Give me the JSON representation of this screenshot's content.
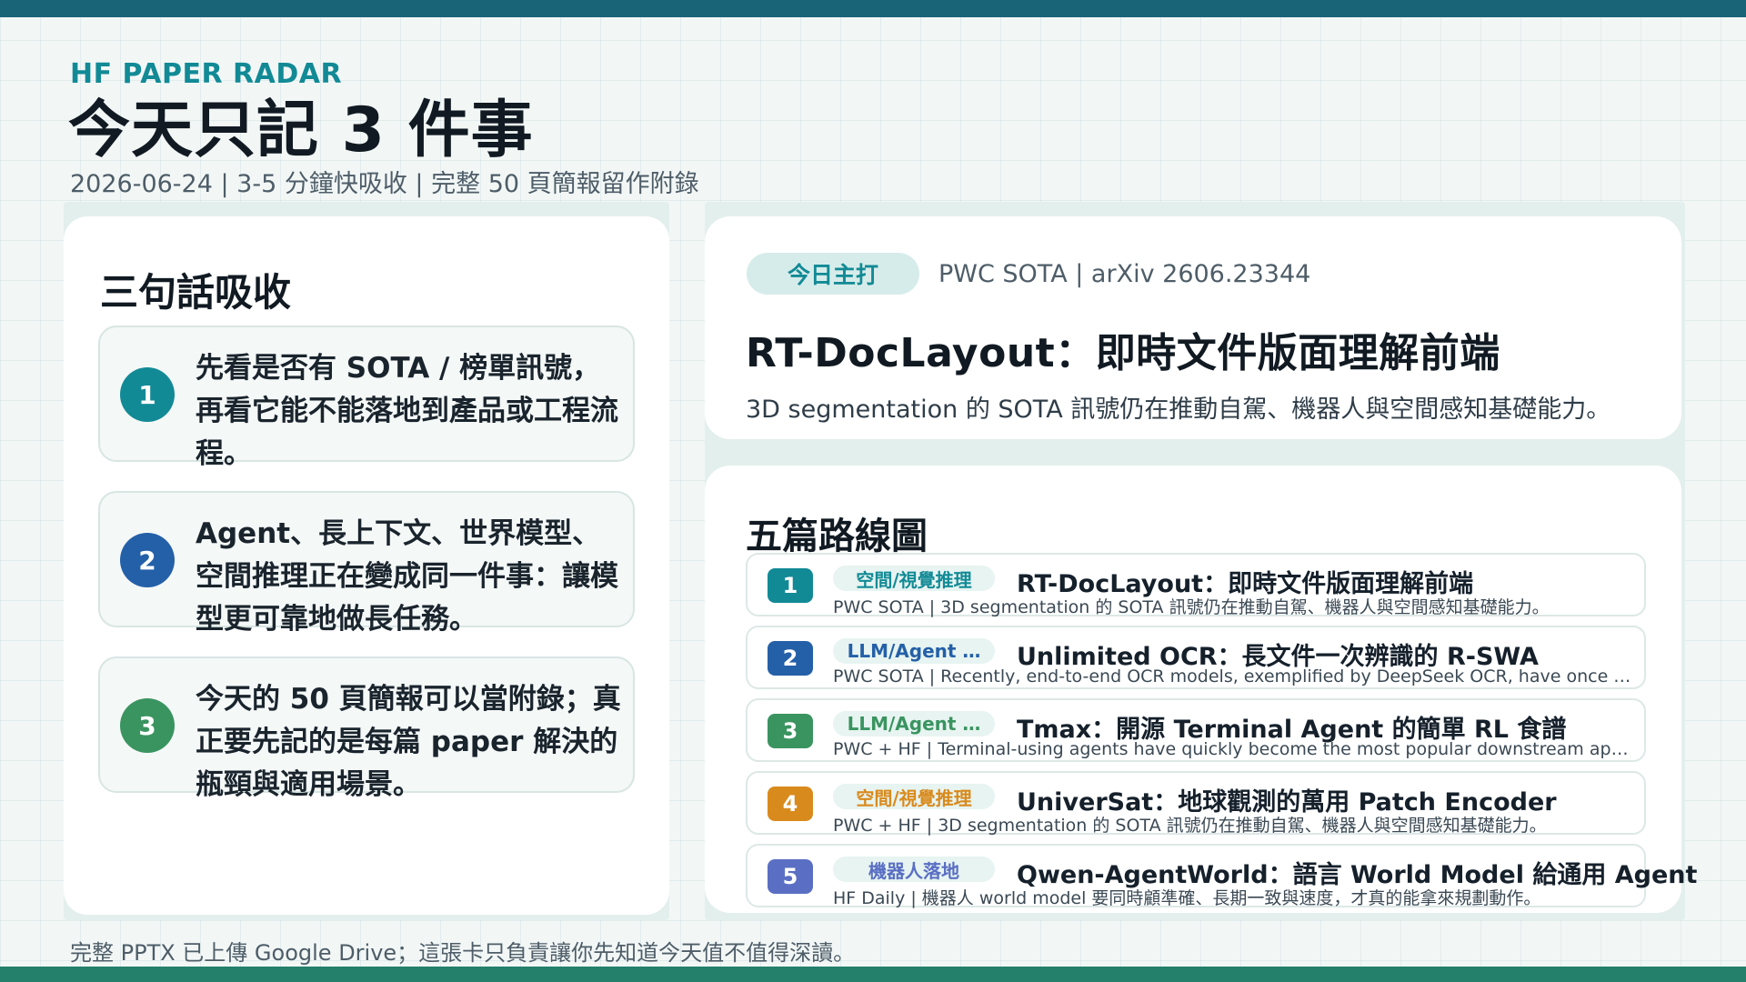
{
  "header": {
    "kicker": "HF PAPER RADAR",
    "title": "今天只記 3 件事",
    "subtitle": "2026-06-24 | 3-5 分鐘快吸收 | 完整 50 頁簡報留作附錄"
  },
  "left": {
    "heading": "三句話吸收",
    "points": [
      {
        "num": "1",
        "text": "先看是否有 SOTA / 榜單訊號，再看它能不能落地到產品或工程流程。",
        "color": "#128a96"
      },
      {
        "num": "2",
        "text": "Agent、長上下文、世界模型、空間推理正在變成同一件事：讓模型更可靠地做長任務。",
        "color": "#2460a8"
      },
      {
        "num": "3",
        "text": "今天的 50 頁簡報可以當附錄；真正要先記的是每篇 paper 解決的瓶頸與適用場景。",
        "color": "#3a9460"
      }
    ]
  },
  "feature": {
    "badge": "今日主打",
    "source": "PWC SOTA | arXiv 2606.23344",
    "title": "RT-DocLayout：即時文件版面理解前端",
    "desc": "3D segmentation 的 SOTA 訊號仍在推動自駕、機器人與空間感知基礎能力。"
  },
  "roadmap": {
    "heading": "五篇路線圖",
    "papers": [
      {
        "num": "1",
        "tag": "空間/視覺推理",
        "title": "RT-DocLayout：即時文件版面理解前端",
        "desc": "PWC SOTA | 3D segmentation 的 SOTA 訊號仍在推動自駕、機器人與空間感知基礎能力。",
        "num_color": "#128a96",
        "tag_color": "#128a96"
      },
      {
        "num": "2",
        "tag": "LLM/Agent …",
        "title": "Unlimited OCR：長文件一次辨識的 R-SWA",
        "desc": "PWC SOTA | Recently, end-to-end OCR models, exemplified by DeepSeek OCR, have once agai…",
        "num_color": "#2460a8",
        "tag_color": "#2460a8"
      },
      {
        "num": "3",
        "tag": "LLM/Agent …",
        "title": "Tmax：開源 Terminal Agent 的簡單 RL 食譜",
        "desc": "PWC + HF | Terminal-using agents have quickly become the most popular downstream applic…",
        "num_color": "#3a9460",
        "tag_color": "#3a9460"
      },
      {
        "num": "4",
        "tag": "空間/視覺推理",
        "title": "UniverSat：地球觀測的萬用 Patch Encoder",
        "desc": "PWC + HF | 3D segmentation 的 SOTA 訊號仍在推動自駕、機器人與空間感知基礎能力。",
        "num_color": "#d98a1c",
        "tag_color": "#d98a1c"
      },
      {
        "num": "5",
        "tag": "機器人落地",
        "title": "Qwen-AgentWorld：語言 World Model 給通用 Agent",
        "desc": "HF Daily | 機器人 world model 要同時顧準確、長期一致與速度，才真的能拿來規劃動作。",
        "num_color": "#5a6fc4",
        "tag_color": "#5a6fc4"
      }
    ]
  },
  "footer": {
    "note": "完整 PPTX 已上傳 Google Drive；這張卡只負責讓你先知道今天值不值得深讀。"
  }
}
